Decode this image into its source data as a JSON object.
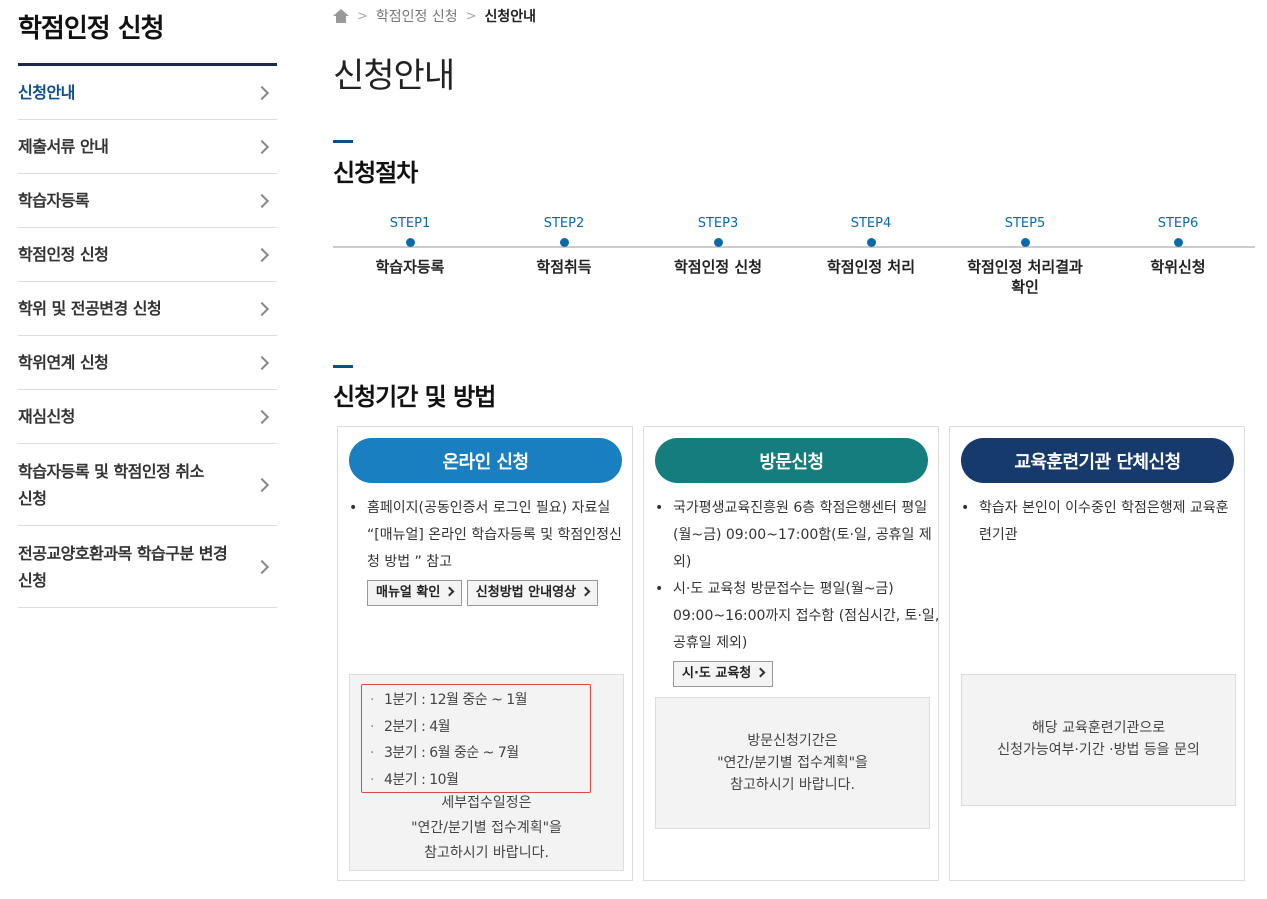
{
  "sidebar": {
    "title": "학점인정 신청",
    "items": [
      {
        "label": "신청안내"
      },
      {
        "label": "제출서류 안내"
      },
      {
        "label": "학습자등록"
      },
      {
        "label": "학점인정 신청"
      },
      {
        "label": "학위 및 전공변경 신청"
      },
      {
        "label": "학위연계 신청"
      },
      {
        "label": "재심신청"
      },
      {
        "label": "학습자등록 및 학점인정 취소 신청"
      },
      {
        "label": "전공교양호환과목 학습구분 변경신청"
      }
    ]
  },
  "breadcrumb": {
    "parent": "학점인정 신청",
    "current": "신청안내"
  },
  "page_title": "신청안내",
  "procedure": {
    "title": "신청절차",
    "steps": [
      {
        "num": "STEP1",
        "name": "학습자등록"
      },
      {
        "num": "STEP2",
        "name": "학점취득"
      },
      {
        "num": "STEP3",
        "name": "학점인정 신청"
      },
      {
        "num": "STEP4",
        "name": "학점인정 처리"
      },
      {
        "num": "STEP5",
        "name": "학점인정 처리결과 확인"
      },
      {
        "num": "STEP6",
        "name": "학위신청"
      }
    ]
  },
  "method": {
    "title": "신청기간 및 방법",
    "online": {
      "header": "온라인 신청",
      "color": "#1a7fc1",
      "bullet1": "홈페이지(공동인증서 로그인 필요) 자료실 “[매뉴얼] 온라인 학습자등록 및 학점인정신청 방법 ”  참고",
      "btn_manual": "매뉴얼 확인",
      "btn_video": "신청방법 안내영상",
      "quarters": [
        "1분기 : 12월 중순 ~ 1월",
        "2분기 : 4월",
        "3분기 : 6월 중순 ~ 7월",
        "4분기 : 10월"
      ],
      "note1": "세부접수일정은",
      "note2": "\"연간/분기별 접수계획\"을",
      "note3": "참고하시기 바랍니다."
    },
    "visit": {
      "header": "방문신청",
      "color": "#157d7d",
      "bullet1": "국가평생교육진흥원 6층 학점은행센터 평일(월~금) 09:00~17:00함(토·일, 공휴일 제외)",
      "bullet2": "시·도 교육청 방문접수는 평일(월~금) 09:00~16:00까지 접수함 (점심시간, 토·일, 공휴일 제외)",
      "btn_office": "시·도 교육청",
      "note1": "방문신청기간은",
      "note2": "\"연간/분기별 접수계획\"을",
      "note3": "참고하시기 바랍니다."
    },
    "group": {
      "header": "교육훈련기관 단체신청",
      "color": "#153a6b",
      "bullet1": "학습자 본인이 이수중인 학점은행제 교육훈련기관",
      "note1": "해당 교육훈련기관으로",
      "note2": "신청가능여부·기간 ·방법 등을 문의"
    }
  }
}
